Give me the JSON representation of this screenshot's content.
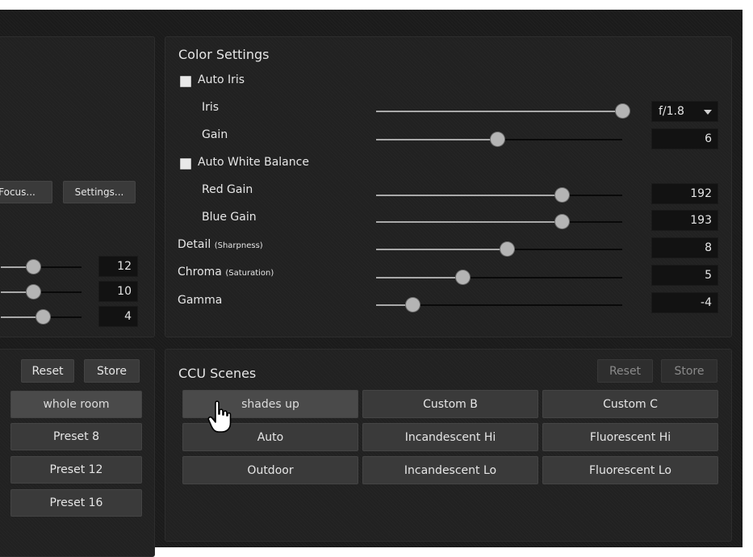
{
  "colors": {
    "background": "#1b1b1b",
    "panel": "#212121",
    "button": "#3a3a3a",
    "value_box": "#121212",
    "slider_knob": "#b4b4b4"
  },
  "left_panel": {
    "buttons": {
      "focus_label": "Focus...",
      "settings_label": "Settings..."
    },
    "sliders": [
      {
        "value": "12"
      },
      {
        "value": "10"
      },
      {
        "value": "4"
      }
    ],
    "presets": {
      "reset_label": "Reset",
      "store_label": "Store",
      "items": [
        "whole room",
        "Preset 8",
        "Preset 12",
        "Preset 16"
      ]
    }
  },
  "color_settings": {
    "title": "Color Settings",
    "auto_iris_label": "Auto Iris",
    "iris": {
      "label": "Iris",
      "value": "f/1.8",
      "level": 1.0
    },
    "gain": {
      "label": "Gain",
      "value": "6",
      "level": 0.49
    },
    "auto_wb_label": "Auto White Balance",
    "red_gain": {
      "label": "Red Gain",
      "value": "192",
      "level": 0.75
    },
    "blue_gain": {
      "label": "Blue Gain",
      "value": "193",
      "level": 0.75
    },
    "detail": {
      "label": "Detail",
      "sub": "(Sharpness)",
      "value": "8",
      "level": 0.53
    },
    "chroma": {
      "label": "Chroma",
      "sub": "(Saturation)",
      "value": "5",
      "level": 0.35
    },
    "gamma": {
      "label": "Gamma",
      "value": "-4",
      "level": 0.15
    }
  },
  "ccu_scenes": {
    "title": "CCU Scenes",
    "reset_label": "Reset",
    "store_label": "Store",
    "scenes": [
      "shades up",
      "Custom B",
      "Custom C",
      "Auto",
      "Incandescent Hi",
      "Fluorescent Hi",
      "Outdoor",
      "Incandescent Lo",
      "Fluorescent Lo"
    ]
  },
  "cursor_icon": "hand-pointer-icon"
}
